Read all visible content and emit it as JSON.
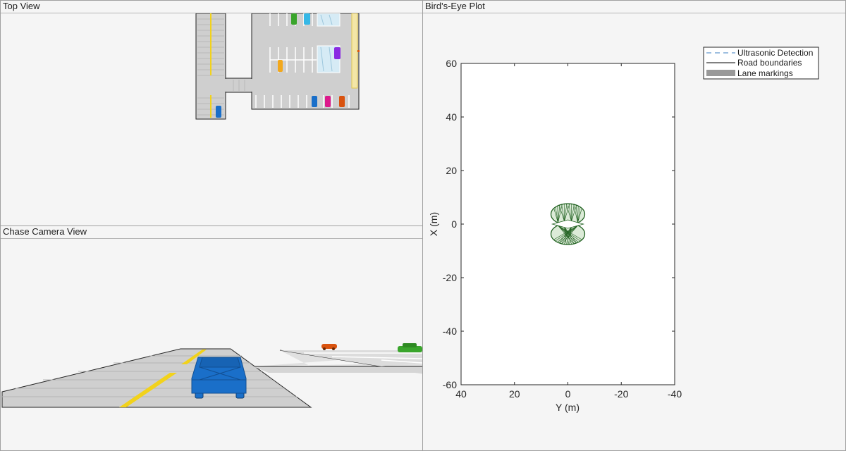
{
  "panels": {
    "top_view": {
      "title": "Top View"
    },
    "chase_view": {
      "title": "Chase Camera View"
    },
    "birds_eye": {
      "title": "Bird's-Eye Plot"
    }
  },
  "chart_data": {
    "type": "scatter",
    "title": "",
    "xlabel": "Y (m)",
    "ylabel": "X (m)",
    "xlim": [
      40,
      -40
    ],
    "ylim": [
      -60,
      60
    ],
    "x_reversed": true,
    "x_ticks": [
      40,
      20,
      0,
      -20,
      -40
    ],
    "y_ticks": [
      60,
      40,
      20,
      0,
      -20,
      -40,
      -60
    ],
    "x_tick_labels": [
      "40",
      "20",
      "0",
      "-20",
      "-40"
    ],
    "y_tick_labels": [
      "60",
      "40",
      "20",
      "0",
      "-20",
      "-40",
      "-60"
    ],
    "grid": false,
    "legend_placement": "top-right outside",
    "legend": [
      {
        "label": "Ultrasonic Detection",
        "style": "dashed-line",
        "color": "#3d7fc0"
      },
      {
        "label": "Road boundaries",
        "style": "solid-line",
        "color": "#000000"
      },
      {
        "label": "Lane markings",
        "style": "patch",
        "color": "#999999"
      }
    ],
    "sensor_coverage": {
      "description_color": "#1c5e1c",
      "fill_color": "#dcebd8",
      "center": [
        0,
        0
      ],
      "lobe_extent_y": [
        -6.5,
        6.5
      ],
      "lobe_extent_x": [
        -7,
        8.5
      ]
    }
  },
  "colors": {
    "road": "#cfcfcf",
    "lane_yellow": "#f2d21b",
    "ego_vehicle": "#1a6fc9",
    "orange_car": "#d9530f",
    "green_car": "#3aa52c",
    "cyan_car": "#36b8e6",
    "purple_car": "#8a2be2",
    "magenta_car": "#dc1a8c",
    "gold_car": "#f2a81d"
  }
}
